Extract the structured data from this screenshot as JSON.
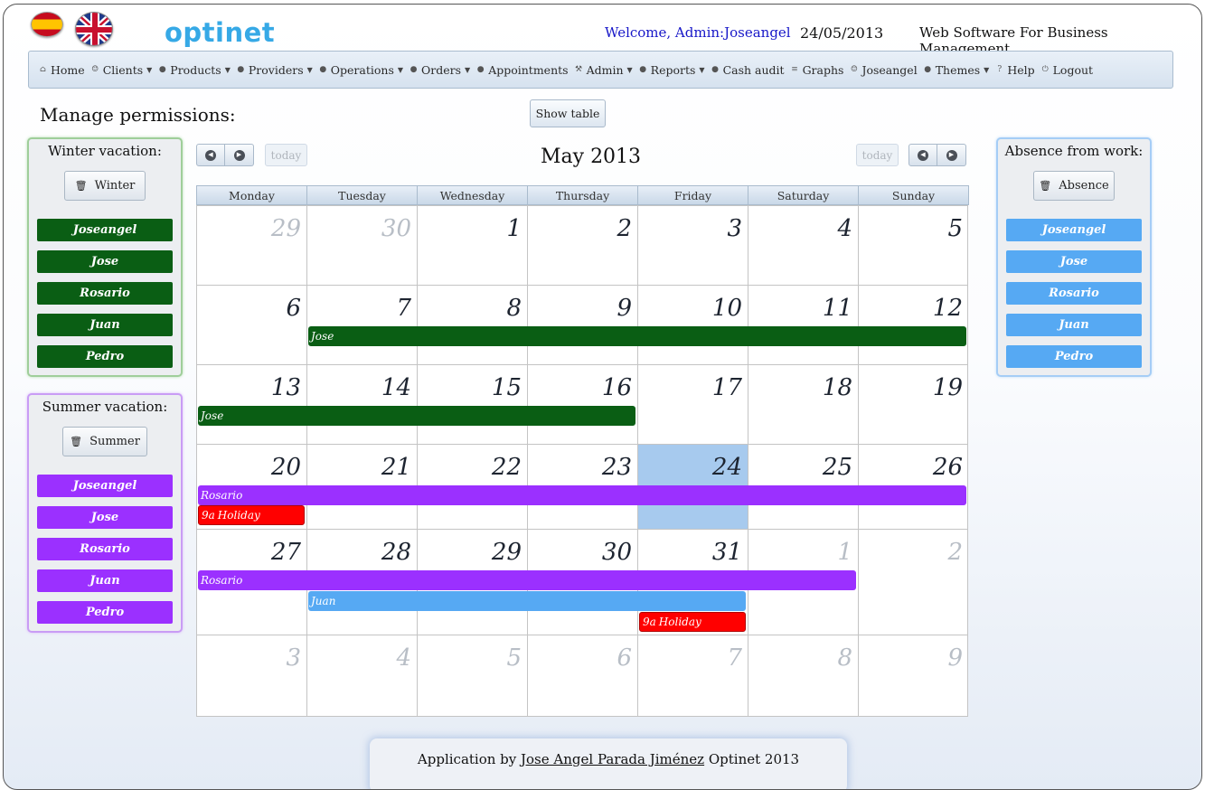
{
  "app": {
    "logo": "optinet"
  },
  "header": {
    "welcome": "Welcome, Admin:Joseangel",
    "date": "24/05/2013",
    "slogan": "Web Software For Business Management."
  },
  "nav": [
    {
      "label": "Home",
      "icon": "home-icon",
      "dropdown": false
    },
    {
      "label": "Clients",
      "icon": "user-icon",
      "dropdown": true
    },
    {
      "label": "Products",
      "icon": "bullet-icon",
      "dropdown": true
    },
    {
      "label": "Providers",
      "icon": "bullet-icon",
      "dropdown": true
    },
    {
      "label": "Operations",
      "icon": "bullet-icon",
      "dropdown": true
    },
    {
      "label": "Orders",
      "icon": "bullet-icon",
      "dropdown": true
    },
    {
      "label": "Appointments",
      "icon": "bullet-icon",
      "dropdown": false
    },
    {
      "label": "Admin",
      "icon": "wrench-icon",
      "dropdown": true
    },
    {
      "label": "Reports",
      "icon": "bullet-icon",
      "dropdown": true
    },
    {
      "label": "Cash audit",
      "icon": "bullet-icon",
      "dropdown": false
    },
    {
      "label": "Graphs",
      "icon": "chart-icon",
      "dropdown": false
    },
    {
      "label": "Joseangel",
      "icon": "user-icon",
      "dropdown": false
    },
    {
      "label": "Themes",
      "icon": "bullet-icon",
      "dropdown": true
    },
    {
      "label": "Help",
      "icon": "help-icon",
      "dropdown": false
    },
    {
      "label": "Logout",
      "icon": "power-icon",
      "dropdown": false
    }
  ],
  "manage": {
    "title": "Manage permissions:",
    "show_table": "Show table"
  },
  "panels": {
    "winter": {
      "title": "Winter vacation:",
      "button": "Winter",
      "color": "#0a5e14",
      "people": [
        "Joseangel",
        "Jose",
        "Rosario",
        "Juan",
        "Pedro"
      ]
    },
    "summer": {
      "title": "Summer vacation:",
      "button": "Summer",
      "color": "#9b30ff",
      "people": [
        "Joseangel",
        "Jose",
        "Rosario",
        "Juan",
        "Pedro"
      ]
    },
    "absence": {
      "title": "Absence from work:",
      "button": "Absence",
      "color": "#56a9f3",
      "people": [
        "Joseangel",
        "Jose",
        "Rosario",
        "Juan",
        "Pedro"
      ]
    }
  },
  "calendar": {
    "title": "May 2013",
    "today_label": "today",
    "weekdays": [
      "Monday",
      "Tuesday",
      "Wednesday",
      "Thursday",
      "Friday",
      "Saturday",
      "Sunday"
    ],
    "weeks": [
      [
        {
          "d": "29",
          "o": true
        },
        {
          "d": "30",
          "o": true
        },
        {
          "d": "1"
        },
        {
          "d": "2"
        },
        {
          "d": "3"
        },
        {
          "d": "4"
        },
        {
          "d": "5"
        }
      ],
      [
        {
          "d": "6"
        },
        {
          "d": "7"
        },
        {
          "d": "8"
        },
        {
          "d": "9"
        },
        {
          "d": "10"
        },
        {
          "d": "11"
        },
        {
          "d": "12"
        }
      ],
      [
        {
          "d": "13"
        },
        {
          "d": "14"
        },
        {
          "d": "15"
        },
        {
          "d": "16"
        },
        {
          "d": "17"
        },
        {
          "d": "18"
        },
        {
          "d": "19"
        }
      ],
      [
        {
          "d": "20"
        },
        {
          "d": "21"
        },
        {
          "d": "22"
        },
        {
          "d": "23"
        },
        {
          "d": "24",
          "today": true
        },
        {
          "d": "25"
        },
        {
          "d": "26"
        }
      ],
      [
        {
          "d": "27"
        },
        {
          "d": "28"
        },
        {
          "d": "29"
        },
        {
          "d": "30"
        },
        {
          "d": "31"
        },
        {
          "d": "1",
          "o": true
        },
        {
          "d": "2",
          "o": true
        }
      ],
      [
        {
          "d": "3",
          "o": true
        },
        {
          "d": "4",
          "o": true
        },
        {
          "d": "5",
          "o": true
        },
        {
          "d": "6",
          "o": true
        },
        {
          "d": "7",
          "o": true
        },
        {
          "d": "8",
          "o": true
        },
        {
          "d": "9",
          "o": true
        }
      ]
    ],
    "events": [
      {
        "title": "Jose",
        "time": "",
        "week": 1,
        "start": 1,
        "end": 6,
        "color": "#0a5e14",
        "lane": 0
      },
      {
        "title": "Jose",
        "time": "",
        "week": 2,
        "start": 0,
        "end": 3,
        "color": "#0a5e14",
        "lane": 0
      },
      {
        "title": "Rosario",
        "time": "",
        "week": 3,
        "start": 0,
        "end": 6,
        "color": "#9b30ff",
        "lane": 0
      },
      {
        "title": "Holiday",
        "time": "9a",
        "week": 3,
        "start": 0,
        "end": 0,
        "color": "#ff0000",
        "lane": 1
      },
      {
        "title": "Rosario",
        "time": "",
        "week": 4,
        "start": 0,
        "end": 5,
        "color": "#9b30ff",
        "lane": 0
      },
      {
        "title": "Juan",
        "time": "",
        "week": 4,
        "start": 1,
        "end": 4,
        "color": "#56a9f3",
        "lane": 1
      },
      {
        "title": "Holiday",
        "time": "9a",
        "week": 4,
        "start": 4,
        "end": 4,
        "color": "#ff0000",
        "lane": 2
      }
    ]
  },
  "footer": {
    "prefix": "Application by ",
    "author": "Jose Angel Parada Jiménez",
    "suffix": " Optinet 2013"
  }
}
